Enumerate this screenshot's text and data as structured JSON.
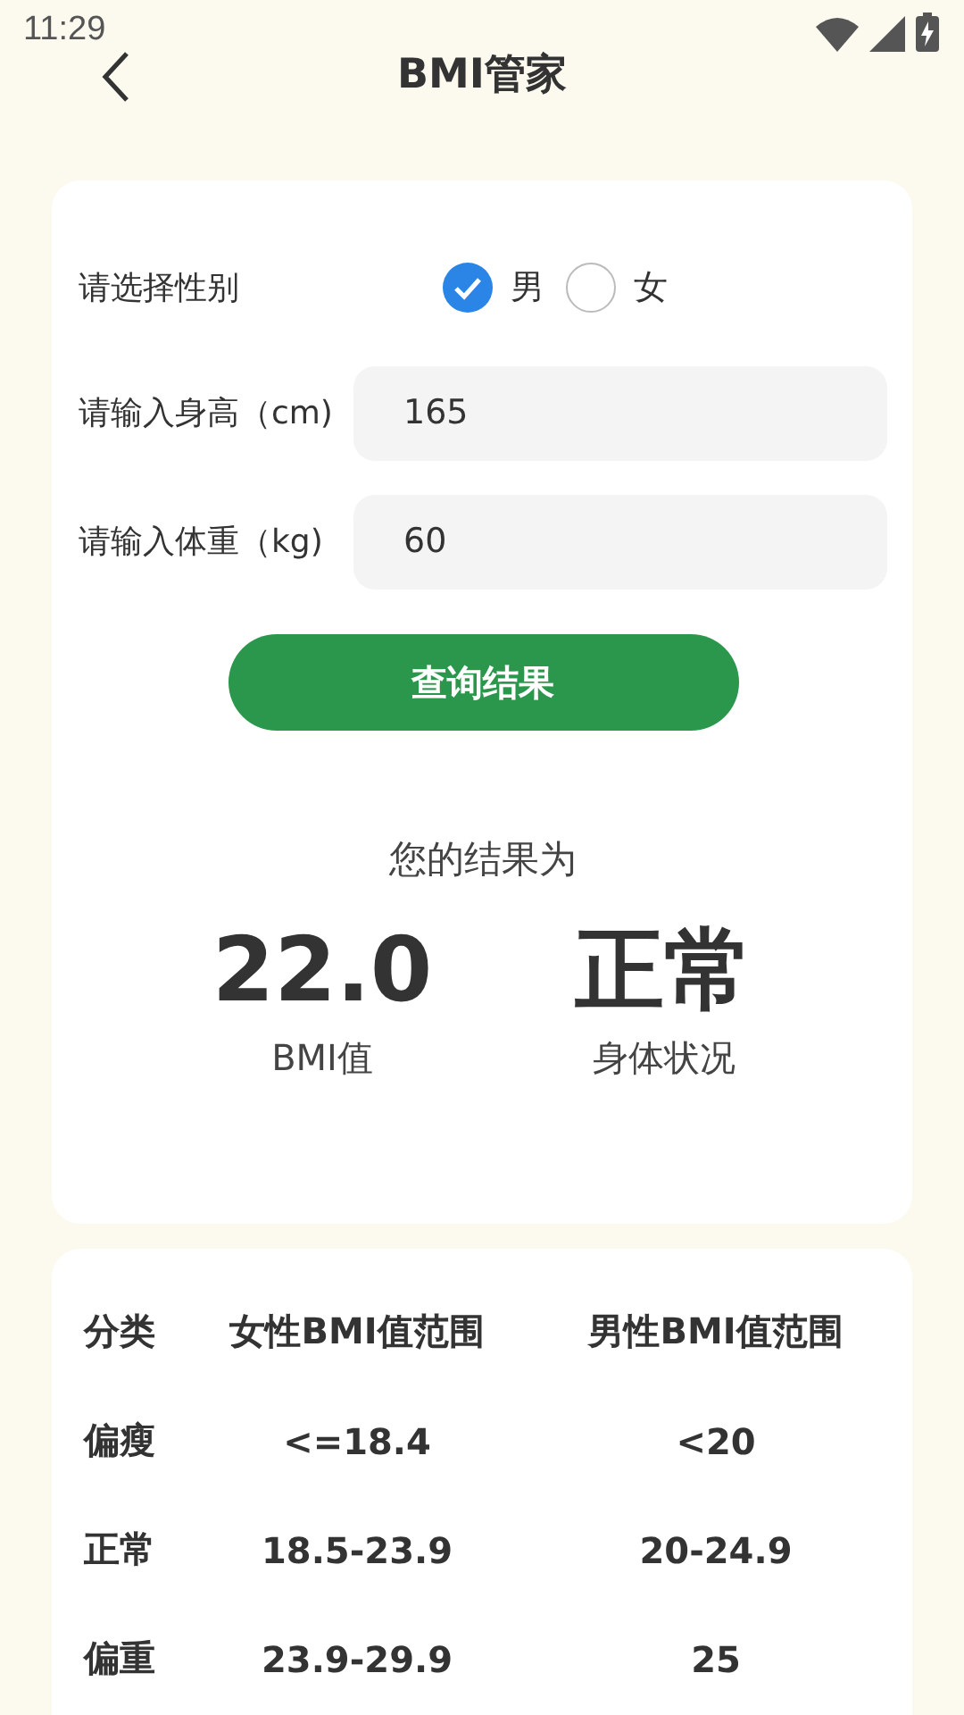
{
  "status_bar": {
    "time": "11:29"
  },
  "header": {
    "title": "BMI管家"
  },
  "form": {
    "gender_label": "请选择性别",
    "genders": [
      {
        "label": "男",
        "selected": true
      },
      {
        "label": "女",
        "selected": false
      }
    ],
    "fields": [
      {
        "label": "请输入身高（cm)",
        "value": "165"
      },
      {
        "label": "请输入体重（kg)",
        "value": "60"
      }
    ],
    "button": "查询结果"
  },
  "result": {
    "heading": "您的结果为",
    "items": [
      {
        "value": "22.0",
        "label": "BMI值"
      },
      {
        "value": "正常",
        "label": "身体状况"
      }
    ]
  },
  "table": {
    "columns": [
      "分类",
      "女性BMI值范围",
      "男性BMI值范围"
    ],
    "rows": [
      [
        "偏瘦",
        "<=18.4",
        "<20"
      ],
      [
        "正常",
        "18.5-23.9",
        "20-24.9"
      ],
      [
        "偏重",
        "23.9-29.9",
        "25"
      ]
    ]
  }
}
